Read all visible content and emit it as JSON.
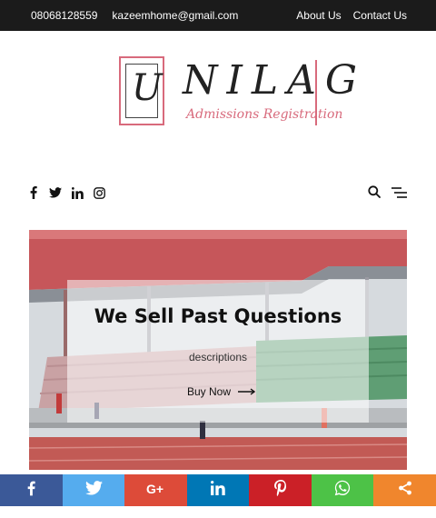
{
  "topbar": {
    "phone": "08068128559",
    "email": "kazeemhome@gmail.com",
    "links": [
      "About Us",
      "Contact Us"
    ]
  },
  "logo": {
    "letter": "U",
    "word": "NILAG",
    "subtitle": "Admissions Registration"
  },
  "social_icons": [
    "facebook-icon",
    "twitter-icon",
    "linkedin-icon",
    "instagram-icon"
  ],
  "tools": [
    "search-icon",
    "menu-icon"
  ],
  "hero": {
    "title": "We Sell Past Questions",
    "description": "descriptions",
    "button_label": "Buy Now"
  },
  "share_bar": [
    {
      "icon": "facebook-icon",
      "color": "#3b5998"
    },
    {
      "icon": "twitter-icon",
      "color": "#55acee"
    },
    {
      "icon": "google-plus-icon",
      "color": "#dd4b39"
    },
    {
      "icon": "linkedin-icon",
      "color": "#0077b5"
    },
    {
      "icon": "pinterest-icon",
      "color": "#cb2027"
    },
    {
      "icon": "whatsapp-icon",
      "color": "#4dc247"
    },
    {
      "icon": "share-icon",
      "color": "#f0862d"
    }
  ]
}
